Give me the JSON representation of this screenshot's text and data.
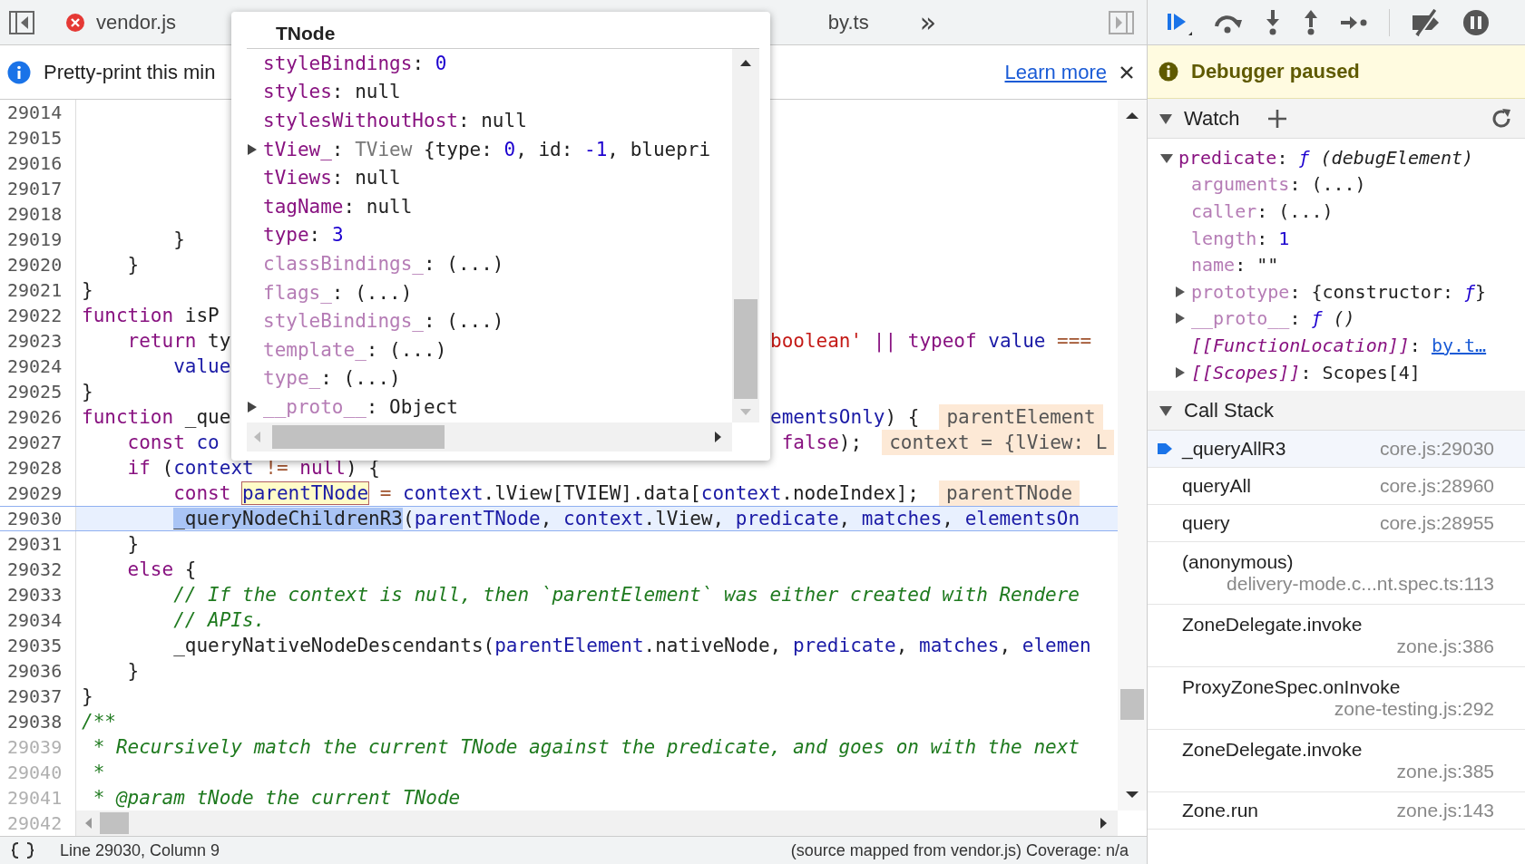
{
  "tabs": [
    {
      "label": "vendor.js",
      "kind": "error"
    },
    {
      "label": "by.ts",
      "kind": "plain"
    }
  ],
  "more_tabs": "»",
  "infobar": {
    "text": "Pretty-print this min",
    "link": "Learn more"
  },
  "editor": {
    "lines": [
      {
        "number": "29014",
        "dim": false,
        "current": false,
        "kind": "full"
      },
      {
        "number": "29015",
        "dim": false,
        "current": false,
        "kind": "full"
      },
      {
        "number": "29016",
        "dim": false,
        "current": false,
        "kind": "full"
      },
      {
        "number": "29017",
        "dim": false,
        "current": false,
        "kind": "full"
      },
      {
        "number": "29018",
        "dim": false,
        "current": false,
        "kind": "full"
      },
      {
        "number": "29019",
        "dim": false,
        "current": false,
        "kind": "full",
        "segments": [
          {
            "text": "        }",
            "kind": "plain"
          }
        ]
      },
      {
        "number": "29020",
        "dim": false,
        "current": false,
        "kind": "full",
        "segments": [
          {
            "text": "    }",
            "kind": "plain"
          }
        ]
      },
      {
        "number": "29021",
        "dim": false,
        "current": false,
        "kind": "full",
        "segments": [
          {
            "text": "}",
            "kind": "plain"
          }
        ]
      },
      {
        "number": "29022",
        "dim": false,
        "current": false,
        "kind": "split",
        "segments": [
          {
            "text": "function",
            "kind": "kw"
          },
          {
            "text": " isP",
            "kind": "plain"
          }
        ]
      },
      {
        "number": "29023",
        "dim": false,
        "current": false,
        "kind": "split",
        "segments": [
          {
            "text": "    return",
            "kind": "kw"
          },
          {
            "text": " ty",
            "kind": "plain"
          }
        ],
        "right": [
          {
            "text": "boolean'",
            "kind": "str"
          },
          {
            "text": " || ",
            "kind": "kw"
          },
          {
            "text": "typeof",
            "kind": "kw"
          },
          {
            "text": " value",
            "kind": "var"
          },
          {
            "text": " ===",
            "kind": "op"
          }
        ]
      },
      {
        "number": "29024",
        "dim": false,
        "current": false,
        "kind": "split",
        "segments": [
          {
            "text": "        value",
            "kind": "var"
          }
        ]
      },
      {
        "number": "29025",
        "dim": false,
        "current": false,
        "kind": "full",
        "segments": [
          {
            "text": "}",
            "kind": "plain"
          }
        ]
      },
      {
        "number": "29026",
        "dim": false,
        "current": false,
        "kind": "split",
        "segments": [
          {
            "text": "function",
            "kind": "kw"
          },
          {
            "text": " _que",
            "kind": "plain"
          }
        ],
        "right": [
          {
            "text": "ementsOnly",
            "kind": "var"
          },
          {
            "text": ") {",
            "kind": "plain"
          }
        ],
        "inline_value": "parentElement"
      },
      {
        "number": "29027",
        "dim": false,
        "current": false,
        "kind": "split",
        "segments": [
          {
            "text": "    const",
            "kind": "kw"
          },
          {
            "text": " co",
            "kind": "var"
          }
        ],
        "right": [
          {
            "text": " false",
            "kind": "kw"
          },
          {
            "text": ");",
            "kind": "plain"
          }
        ],
        "inline_value": "context = {lView: L"
      },
      {
        "number": "29028",
        "dim": false,
        "current": false,
        "kind": "full",
        "segments": [
          {
            "text": "    if",
            "kind": "kw"
          },
          {
            "text": " (",
            "kind": "plain"
          },
          {
            "text": "context",
            "kind": "var"
          },
          {
            "text": " != ",
            "kind": "op"
          },
          {
            "text": "null",
            "kind": "kw"
          },
          {
            "text": ") {",
            "kind": "plain"
          }
        ]
      },
      {
        "number": "29029",
        "dim": false,
        "current": false,
        "kind": "full",
        "segments": [
          {
            "text": "        const ",
            "kind": "kw"
          },
          {
            "text": "parentTNode",
            "kind": "hover"
          },
          {
            "text": " = ",
            "kind": "op"
          },
          {
            "text": "context",
            "kind": "var"
          },
          {
            "text": ".lView[TVIEW].data[",
            "kind": "plain"
          },
          {
            "text": "context",
            "kind": "var"
          },
          {
            "text": ".nodeIndex];",
            "kind": "plain"
          }
        ],
        "inline_value": "parentTNode"
      },
      {
        "number": "29030",
        "dim": false,
        "current": true,
        "kind": "full",
        "segments": [
          {
            "text": "        _queryNodeChildrenR3",
            "kind": "exec"
          },
          {
            "text": "(",
            "kind": "plain"
          },
          {
            "text": "parentTNode",
            "kind": "var"
          },
          {
            "text": ", ",
            "kind": "plain"
          },
          {
            "text": "context",
            "kind": "var"
          },
          {
            "text": ".lView, ",
            "kind": "plain"
          },
          {
            "text": "predicate",
            "kind": "var"
          },
          {
            "text": ", ",
            "kind": "plain"
          },
          {
            "text": "matches",
            "kind": "var"
          },
          {
            "text": ", ",
            "kind": "plain"
          },
          {
            "text": "elementsOn",
            "kind": "var"
          }
        ]
      },
      {
        "number": "29031",
        "dim": false,
        "current": false,
        "kind": "full",
        "segments": [
          {
            "text": "    }",
            "kind": "plain"
          }
        ]
      },
      {
        "number": "29032",
        "dim": false,
        "current": false,
        "kind": "full",
        "segments": [
          {
            "text": "    else",
            "kind": "kw"
          },
          {
            "text": " {",
            "kind": "plain"
          }
        ]
      },
      {
        "number": "29033",
        "dim": false,
        "current": false,
        "kind": "full",
        "segments": [
          {
            "text": "        // If the context is null, then `parentElement` was either created with Rendere",
            "kind": "comment"
          }
        ]
      },
      {
        "number": "29034",
        "dim": false,
        "current": false,
        "kind": "full",
        "segments": [
          {
            "text": "        // APIs.",
            "kind": "comment"
          }
        ]
      },
      {
        "number": "29035",
        "dim": false,
        "current": false,
        "kind": "full",
        "segments": [
          {
            "text": "        _queryNativeNodeDescendants(",
            "kind": "plain"
          },
          {
            "text": "parentElement",
            "kind": "var"
          },
          {
            "text": ".nativeNode, ",
            "kind": "plain"
          },
          {
            "text": "predicate",
            "kind": "var"
          },
          {
            "text": ", ",
            "kind": "plain"
          },
          {
            "text": "matches",
            "kind": "var"
          },
          {
            "text": ", ",
            "kind": "plain"
          },
          {
            "text": "elemen",
            "kind": "var"
          }
        ]
      },
      {
        "number": "29036",
        "dim": false,
        "current": false,
        "kind": "full",
        "segments": [
          {
            "text": "    }",
            "kind": "plain"
          }
        ]
      },
      {
        "number": "29037",
        "dim": false,
        "current": false,
        "kind": "full",
        "segments": [
          {
            "text": "}",
            "kind": "plain"
          }
        ]
      },
      {
        "number": "29038",
        "dim": false,
        "current": false,
        "kind": "full",
        "segments": [
          {
            "text": "/**",
            "kind": "comment"
          }
        ]
      },
      {
        "number": "29039",
        "dim": true,
        "current": false,
        "kind": "full",
        "segments": [
          {
            "text": " * Recursively match the current TNode against the predicate, and goes on with the next",
            "kind": "comment"
          }
        ]
      },
      {
        "number": "29040",
        "dim": true,
        "current": false,
        "kind": "full",
        "segments": [
          {
            "text": " *",
            "kind": "comment"
          }
        ]
      },
      {
        "number": "29041",
        "dim": true,
        "current": false,
        "kind": "full",
        "segments": [
          {
            "text": " * @param tNode the current TNode",
            "kind": "comment"
          }
        ]
      },
      {
        "number": "29042",
        "dim": true,
        "current": false,
        "kind": "scrollbar"
      }
    ]
  },
  "popover": {
    "title": "TNode",
    "entries": [
      {
        "name": "styleBindings",
        "dimmed": false,
        "kind": "leaf",
        "value": [
          {
            "text": ": ",
            "kind": "plain"
          },
          {
            "text": "0",
            "kind": "num"
          }
        ]
      },
      {
        "name": "styles",
        "dimmed": false,
        "kind": "leaf",
        "value": [
          {
            "text": ": null",
            "kind": "plain"
          }
        ]
      },
      {
        "name": "stylesWithoutHost",
        "dimmed": false,
        "kind": "leaf",
        "value": [
          {
            "text": ": null",
            "kind": "plain"
          }
        ]
      },
      {
        "name": "tView_",
        "dimmed": false,
        "kind": "expandable",
        "expanded": false,
        "value": [
          {
            "text": ": ",
            "kind": "plain"
          },
          {
            "text": "TView",
            "kind": "class"
          },
          {
            "text": " {type: ",
            "kind": "plain"
          },
          {
            "text": "0",
            "kind": "num"
          },
          {
            "text": ", id: ",
            "kind": "plain"
          },
          {
            "text": "-1",
            "kind": "num"
          },
          {
            "text": ", bluepri",
            "kind": "plain"
          }
        ]
      },
      {
        "name": "tViews",
        "dimmed": false,
        "kind": "leaf",
        "value": [
          {
            "text": ": null",
            "kind": "plain"
          }
        ]
      },
      {
        "name": "tagName",
        "dimmed": false,
        "kind": "leaf",
        "value": [
          {
            "text": ": null",
            "kind": "plain"
          }
        ]
      },
      {
        "name": "type",
        "dimmed": false,
        "kind": "leaf",
        "value": [
          {
            "text": ": ",
            "kind": "plain"
          },
          {
            "text": "3",
            "kind": "num"
          }
        ]
      },
      {
        "name": "classBindings_",
        "dimmed": true,
        "kind": "leaf",
        "value": [
          {
            "text": ": (...)",
            "kind": "plain"
          }
        ]
      },
      {
        "name": "flags_",
        "dimmed": true,
        "kind": "leaf",
        "value": [
          {
            "text": ": (...)",
            "kind": "plain"
          }
        ]
      },
      {
        "name": "styleBindings_",
        "dimmed": true,
        "kind": "leaf",
        "value": [
          {
            "text": ": (...)",
            "kind": "plain"
          }
        ]
      },
      {
        "name": "template_",
        "dimmed": true,
        "kind": "leaf",
        "value": [
          {
            "text": ": (...)",
            "kind": "plain"
          }
        ]
      },
      {
        "name": "type_",
        "dimmed": true,
        "kind": "leaf",
        "value": [
          {
            "text": ": (...)",
            "kind": "plain"
          }
        ]
      },
      {
        "name": "__proto__",
        "dimmed": true,
        "kind": "expandable",
        "expanded": false,
        "value": [
          {
            "text": ": Object",
            "kind": "plain"
          }
        ]
      }
    ]
  },
  "paused_banner": "Debugger paused",
  "watch": {
    "title": "Watch",
    "expanded": true,
    "entries": [
      {
        "name": "predicate",
        "dimmed": false,
        "internal": false,
        "kind": "expandable",
        "expanded": true,
        "value": [
          {
            "text": ": ",
            "kind": "plain"
          },
          {
            "text": "ƒ",
            "kind": "func"
          },
          {
            "text": " (debugElement)",
            "kind": "italic"
          }
        ],
        "children": [
          {
            "name": "arguments",
            "dimmed": true,
            "internal": false,
            "kind": "leaf",
            "value": [
              {
                "text": ": (...)",
                "kind": "plain"
              }
            ]
          },
          {
            "name": "caller",
            "dimmed": true,
            "internal": false,
            "kind": "leaf",
            "value": [
              {
                "text": ": (...)",
                "kind": "plain"
              }
            ]
          },
          {
            "name": "length",
            "dimmed": true,
            "internal": false,
            "kind": "leaf",
            "value": [
              {
                "text": ": ",
                "kind": "plain"
              },
              {
                "text": "1",
                "kind": "num"
              }
            ]
          },
          {
            "name": "name",
            "dimmed": true,
            "internal": false,
            "kind": "leaf",
            "value": [
              {
                "text": ": \"\"",
                "kind": "plain"
              }
            ]
          },
          {
            "name": "prototype",
            "dimmed": true,
            "internal": false,
            "kind": "expandable",
            "expanded": false,
            "value": [
              {
                "text": ": {constructor: ",
                "kind": "plain"
              },
              {
                "text": "ƒ",
                "kind": "func"
              },
              {
                "text": "}",
                "kind": "plain"
              }
            ]
          },
          {
            "name": "__proto__",
            "dimmed": true,
            "internal": false,
            "kind": "expandable",
            "expanded": false,
            "value": [
              {
                "text": ": ",
                "kind": "plain"
              },
              {
                "text": "ƒ",
                "kind": "func"
              },
              {
                "text": " ()",
                "kind": "italic"
              }
            ]
          },
          {
            "name": "[[FunctionLocation]]",
            "dimmed": false,
            "internal": true,
            "kind": "leaf",
            "value": [
              {
                "text": ": ",
                "kind": "plain"
              },
              {
                "text": "by.t…",
                "kind": "link"
              }
            ]
          },
          {
            "name": "[[Scopes]]",
            "dimmed": false,
            "internal": true,
            "kind": "expandable",
            "expanded": false,
            "value": [
              {
                "text": ": Scopes[4]",
                "kind": "plain"
              }
            ]
          }
        ]
      }
    ]
  },
  "call_stack": {
    "title": "Call Stack",
    "expanded": true,
    "frames": [
      {
        "name": "_queryAllR3",
        "location": "core.js:29030",
        "selected": true,
        "kind": "inline"
      },
      {
        "name": "queryAll",
        "location": "core.js:28960",
        "selected": false,
        "kind": "inline"
      },
      {
        "name": "query",
        "location": "core.js:28955",
        "selected": false,
        "kind": "inline"
      },
      {
        "name": "(anonymous)",
        "location": "delivery-mode.c...nt.spec.ts:113",
        "selected": false,
        "kind": "stacked"
      },
      {
        "name": "ZoneDelegate.invoke",
        "location": "zone.js:386",
        "selected": false,
        "kind": "stacked"
      },
      {
        "name": "ProxyZoneSpec.onInvoke",
        "location": "zone-testing.js:292",
        "selected": false,
        "kind": "stacked"
      },
      {
        "name": "ZoneDelegate.invoke",
        "location": "zone.js:385",
        "selected": false,
        "kind": "stacked"
      },
      {
        "name": "Zone.run",
        "location": "zone.js:143",
        "selected": false,
        "kind": "inline"
      }
    ]
  },
  "status_bar": {
    "position": "Line 29030, Column 9",
    "source": "(source mapped from vendor.js) Coverage: n/a"
  }
}
